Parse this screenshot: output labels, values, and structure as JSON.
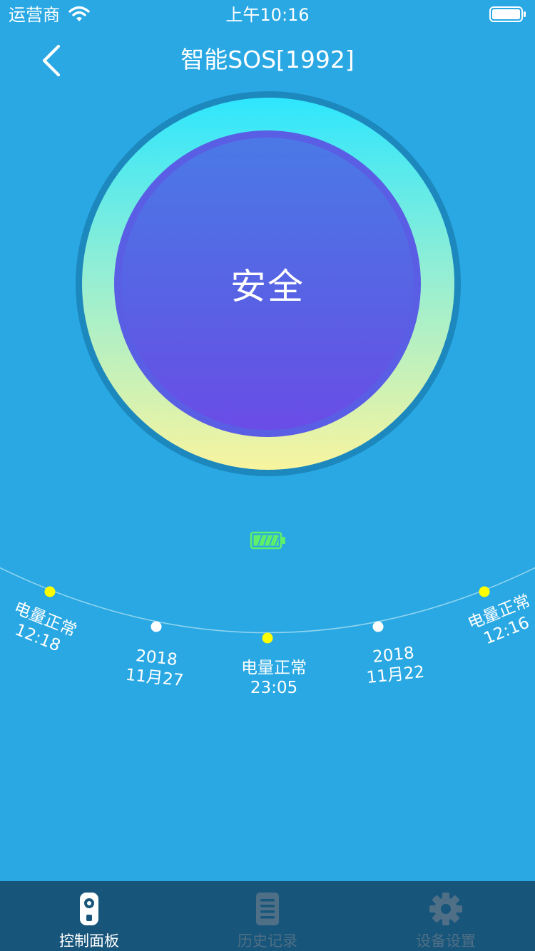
{
  "status_bar": {
    "carrier": "运营商",
    "time": "上午10:16"
  },
  "nav": {
    "title": "智能SOS[1992]"
  },
  "device": {
    "status": "安全"
  },
  "battery": {
    "level_fraction": 1.0,
    "color": "#5ef06b"
  },
  "timeline": {
    "items": [
      {
        "line1": "电量正常",
        "line2": "12:18",
        "dot_color": "#ffff00"
      },
      {
        "line1": "2018",
        "line2": "11月27",
        "dot_color": "#ffffff"
      },
      {
        "line1": "电量正常",
        "line2": "23:05",
        "dot_color": "#ffff00"
      },
      {
        "line1": "2018",
        "line2": "11月22",
        "dot_color": "#ffffff"
      },
      {
        "line1": "电量正常",
        "line2": "12:16",
        "dot_color": "#ffff00"
      }
    ]
  },
  "tabs": [
    {
      "label": "控制面板",
      "icon": "remote-icon",
      "active": true
    },
    {
      "label": "历史记录",
      "icon": "document-icon",
      "active": false
    },
    {
      "label": "设备设置",
      "icon": "gear-icon",
      "active": false
    }
  ],
  "colors": {
    "background": "#29a8e3",
    "tab_bar": "#17557a",
    "tab_inactive": "#4f6f86",
    "ring_top": "#2ee6fd",
    "ring_bottom": "#f8f49e",
    "inner_top": "#4b79e6",
    "inner_bottom": "#6a4ce6"
  }
}
